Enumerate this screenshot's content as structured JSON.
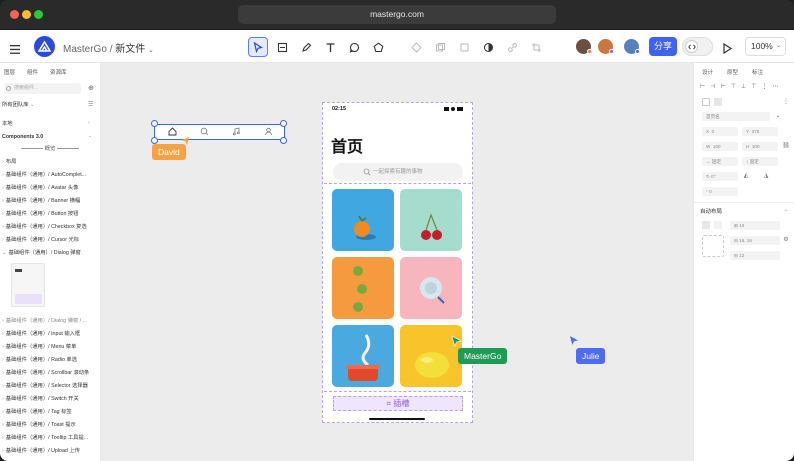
{
  "window": {
    "url": "mastergo.com"
  },
  "toolbar": {
    "app_name": "MasterGo",
    "separator": "/",
    "file_name": "新文件",
    "share_label": "分享",
    "zoom_label": "100%"
  },
  "left_panel": {
    "tabs": [
      "图层",
      "组件",
      "资源库"
    ],
    "search_placeholder": "搜索组件...",
    "team_lib": "所有团队库",
    "local": "本地",
    "library": "Components 3.0",
    "group_overview": "概览",
    "group_layout": "布局",
    "items": [
      "基础组件（通用）/ AutoComplet...",
      "基础组件（通用）/ Avatar 头像",
      "基础组件（通用）/ Banner 横幅",
      "基础组件（通用）/ Button 按钮",
      "基础组件（通用）/ Checkbox 复选",
      "基础组件（通用）/ Cursor 光标",
      "基础组件（通用）/ Dialog 弹窗"
    ],
    "items_after": [
      "基础组件（通用）/ Dialog 弹窗 / ...",
      "基础组件（通用）/ Input 输入框",
      "基础组件（通用）/ Menu 菜单",
      "基础组件（通用）/ Radio 单选",
      "基础组件（通用）/ Scrollbar 滚动条",
      "基础组件（通用）/ Selector 选择器",
      "基础组件（通用）/ Switch 开关",
      "基础组件（通用）/ Tag 标签",
      "基础组件（通用）/ Toast 提示",
      "基础组件（通用）/ Tooltip 工具提...",
      "基础组件（通用）/ Upload 上传"
    ]
  },
  "right_panel": {
    "tabs": [
      "设计",
      "原型",
      "标注"
    ],
    "component_name": "首页名",
    "x_value": "0",
    "y_value": "375",
    "w_value": "100",
    "h_value": "100",
    "fix_label": "固定",
    "fix_label2": "固定",
    "rotation": "0°",
    "radius": "0",
    "auto_layout_title": "自动布局",
    "gap_value": "16",
    "padding_value": "16, 16",
    "padding2_value": "12"
  },
  "canvas": {
    "colors": {
      "selection": "#3f63f0",
      "david": "#f5a246",
      "mastergo": "#1f9b55",
      "julie": "#4d6cf2",
      "slot": "#8c5be6"
    },
    "cursor_labels": {
      "david": "David",
      "mastergo": "MasterGo",
      "julie": "Julie"
    },
    "phone": {
      "time": "02:15",
      "title": "首页",
      "search_placeholder": "一起探索有趣的事物",
      "slot_label": "插槽"
    },
    "tile_colors": [
      "#41a7e0",
      "#a5dccd",
      "#f59a3f",
      "#f7b5be",
      "#4aa9de",
      "#f8c42c"
    ]
  }
}
